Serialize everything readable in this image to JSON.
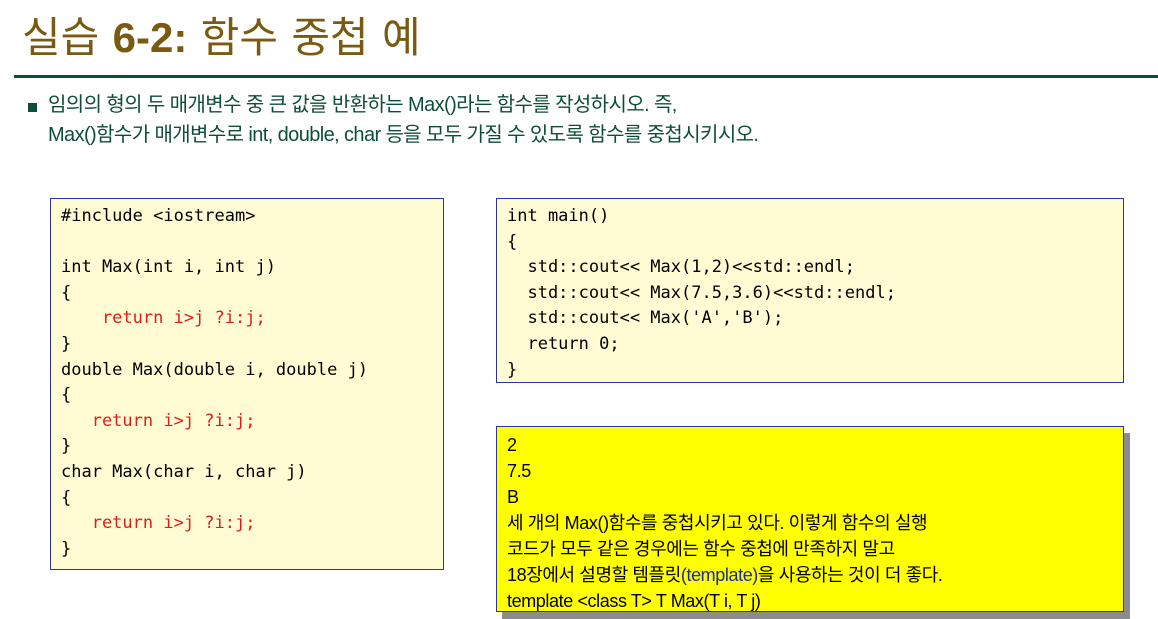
{
  "title": {
    "prefix": "실습 ",
    "number": "6-2:",
    "suffix": " 함수 중첩 예"
  },
  "description": {
    "line1": "임의의 형의 두 매개변수 중 큰 값을 반환하는 Max()라는 함수를 작성하시오. 즉,",
    "line2": "Max()함수가 매개변수로 int, double, char 등을 모두 가질 수 있도록 함수를 중첩시키시오."
  },
  "code_left": {
    "l1": "#include <iostream>",
    "l2": "",
    "l3": "int Max(int i, int j)",
    "l4": "{",
    "l5": "    return i>j ?i:j;",
    "l6": "}",
    "l7": "double Max(double i, double j)",
    "l8": "{",
    "l9": "   return i>j ?i:j;",
    "l10": "}",
    "l11": "char Max(char i, char j)",
    "l12": "{",
    "l13": "   return i>j ?i:j;",
    "l14": "}"
  },
  "code_main": {
    "l1": "int main()",
    "l2": "{",
    "l3": "  std::cout<< Max(1,2)<<std::endl;",
    "l4": "  std::cout<< Max(7.5,3.6)<<std::endl;",
    "l5": "  std::cout<< Max('A','B');",
    "l6": "  return 0;",
    "l7": "}"
  },
  "output": {
    "l1": "2",
    "l2": "7.5",
    "l3": "B",
    "l4": "세 개의 Max()함수를 중첩시키고 있다. 이렇게 함수의 실행",
    "l5": "코드가 모두 같은 경우에는 함수 중첩에 만족하지 말고",
    "l6_a": "18장에서 설명할 템플릿",
    "l6_b": "(template)",
    "l6_c": "을 사용하는 것이 더 좋다.",
    "l7": "template <class T> T Max(T i, T j)"
  },
  "colors": {
    "title": "#7a5a10",
    "rule": "#0f4d3b",
    "text": "#0f4d3b",
    "code_bg": "#fffbd2",
    "code_border": "#2a32a8",
    "code_red": "#e21b1b",
    "output_bg": "#ffff00",
    "template_blue": "#1c2aa8"
  }
}
